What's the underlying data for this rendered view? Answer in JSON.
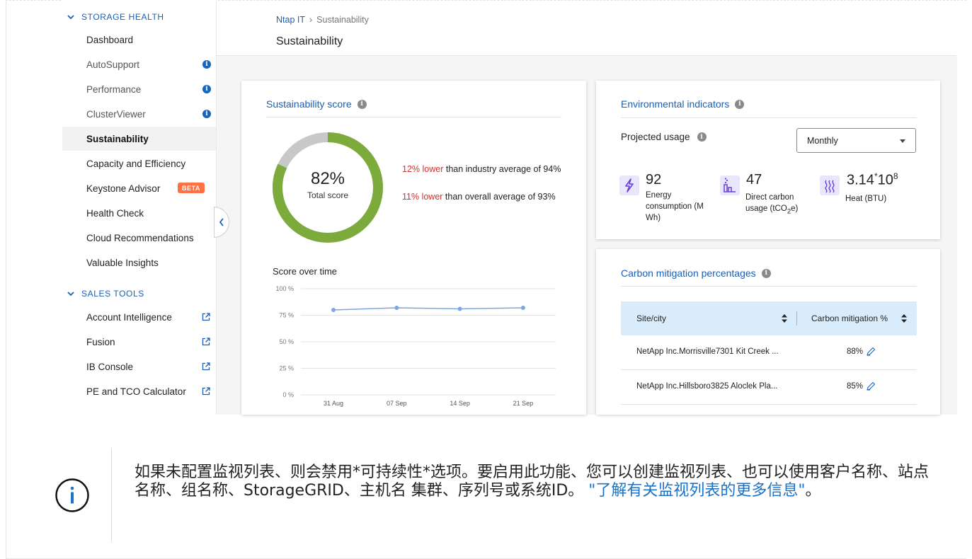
{
  "sidebar": {
    "storage_section": "STORAGE HEALTH",
    "sales_section": "SALES TOOLS",
    "storage_items": [
      {
        "label": "Dashboard"
      },
      {
        "label": "AutoSupport"
      },
      {
        "label": "Performance"
      },
      {
        "label": "ClusterViewer"
      },
      {
        "label": "Sustainability"
      },
      {
        "label": "Capacity and Efficiency"
      },
      {
        "label": "Keystone Advisor"
      },
      {
        "label": "Health Check"
      },
      {
        "label": "Cloud Recommendations"
      },
      {
        "label": "Valuable Insights"
      }
    ],
    "beta_badge": "BETA",
    "sales_items": [
      {
        "label": "Account Intelligence"
      },
      {
        "label": "Fusion"
      },
      {
        "label": "IB Console"
      },
      {
        "label": "PE and TCO Calculator"
      }
    ]
  },
  "header": {
    "breadcrumb_root": "Ntap IT",
    "breadcrumb_sep": "›",
    "breadcrumb_current": "Sustainability",
    "title": "Sustainability"
  },
  "score_card": {
    "title": "Sustainability score",
    "score": "82%",
    "score_fraction": 0.82,
    "score_label": "Total score",
    "industry_highlight": "12% lower",
    "industry_text": " than industry average of 94%",
    "overall_highlight": "11% lower",
    "overall_text": " than overall average of 93%",
    "chart_title": "Score over time"
  },
  "chart_data": {
    "type": "line",
    "title": "Score over time",
    "categories": [
      "31 Aug",
      "07 Sep",
      "14 Sep",
      "21 Sep"
    ],
    "values": [
      80,
      82,
      81,
      82
    ],
    "ylim": [
      0,
      100
    ],
    "yticks": [
      "100 %",
      "75 %",
      "50 %",
      "25 %",
      "0 %"
    ],
    "ytick_values": [
      100,
      75,
      50,
      25,
      0
    ],
    "grid": true,
    "color": "#7ea6e0"
  },
  "environment": {
    "title": "Environmental indicators",
    "projected_label": "Projected usage",
    "period": "Monthly",
    "energy_value": "92",
    "energy_label": "Energy consumption (M Wh)",
    "carbon_value": "47",
    "carbon_label_pre": "Direct carbon usage (tCO",
    "carbon_label_sub": "2",
    "carbon_label_post": "e)",
    "heat_value": "3.14",
    "heat_mult": "*",
    "heat_base": "10",
    "heat_exp": "8",
    "heat_label": "Heat (BTU)"
  },
  "mitigation": {
    "title": "Carbon mitigation percentages",
    "col_site": "Site/city",
    "col_pct": "Carbon mitigation %",
    "rows": [
      {
        "site": "NetApp Inc.Morrisville7301 Kit Creek ...",
        "pct": "88%"
      },
      {
        "site": "NetApp Inc.Hillsboro3825 Aloclek Pla...",
        "pct": "85%"
      }
    ]
  },
  "note": {
    "text": "如果未配置监视列表、则会禁用*可持续性*选项。要启用此功能、您可以创建监视列表、也可以使用客户名称、站点名称、组名称、StorageGRID、主机名 集群、序列号或系统ID。 ",
    "link": "\"了解有关监视列表的更多信息\"",
    "tail": "。"
  },
  "colors": {
    "accent": "#1a5fb4",
    "score_ring": "#7cab3c",
    "ring_track": "#c8c8c8",
    "negative": "#d32f2f",
    "table_header": "#d9ecfb"
  }
}
